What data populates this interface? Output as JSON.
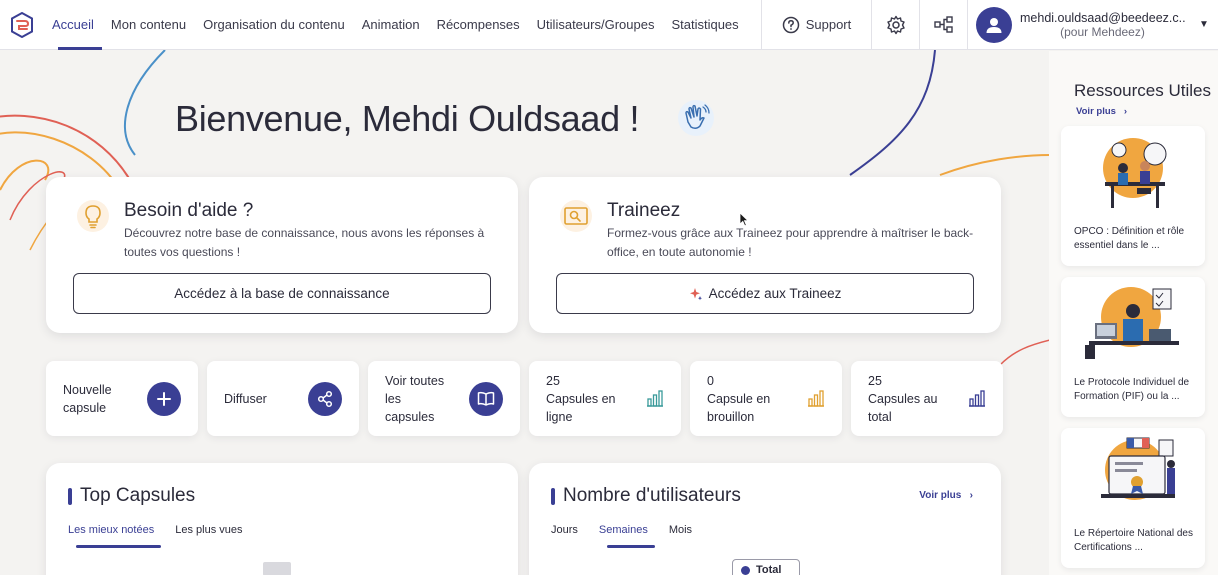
{
  "nav": {
    "items": [
      "Accueil",
      "Mon contenu",
      "Organisation du contenu",
      "Animation",
      "Récompenses",
      "Utilisateurs/Groupes",
      "Statistiques"
    ],
    "support_label": "Support"
  },
  "user": {
    "email": "mehdi.ouldsaad@beedeez.c...",
    "org": "(pour Mehdeez)"
  },
  "welcome": "Bienvenue, Mehdi Ouldsaad !",
  "help_card": {
    "title": "Besoin d'aide ?",
    "desc": "Découvrez notre base de connaissance, nous avons les réponses à toutes vos questions !",
    "button": "Accédez à la base de connaissance"
  },
  "trainee_card": {
    "title": "Traineez",
    "desc": "Formez-vous grâce aux Traineez pour apprendre à maîtriser le back-office, en toute autonomie !",
    "button": "Accédez aux Traineez"
  },
  "tiles": [
    {
      "lines": [
        "Nouvelle",
        "capsule"
      ]
    },
    {
      "lines": [
        "Diffuser"
      ]
    },
    {
      "lines": [
        "Voir toutes",
        "les",
        "capsules"
      ]
    },
    {
      "lines": [
        "25",
        "Capsules en",
        "ligne"
      ]
    },
    {
      "lines": [
        "0",
        "Capsule en",
        "brouillon"
      ]
    },
    {
      "lines": [
        "25",
        "Capsules au",
        "total"
      ]
    }
  ],
  "top_capsules": {
    "title": "Top Capsules",
    "tabs": [
      "Les mieux notées",
      "Les plus vues"
    ]
  },
  "users_panel": {
    "title": "Nombre d'utilisateurs",
    "see_more": "Voir plus",
    "tabs": [
      "Jours",
      "Semaines",
      "Mois"
    ],
    "legend": "Total"
  },
  "sidebar": {
    "title": "Ressources Utiles",
    "see_more": "Voir plus",
    "resources": [
      {
        "title": "OPCO : Définition et rôle essentiel dans le ..."
      },
      {
        "title": "Le Protocole Individuel de Formation (PIF) ou la ..."
      },
      {
        "title": "Le Répertoire National des Certifications ..."
      }
    ]
  },
  "colors": {
    "accent": "#3a3f94",
    "stat_teal": "#3a9a9a",
    "stat_orange": "#e0a030",
    "stat_indigo": "#3a3f94",
    "deco_orange": "#f0a640",
    "deco_red": "#e06055",
    "deco_blue": "#4a90c8"
  }
}
